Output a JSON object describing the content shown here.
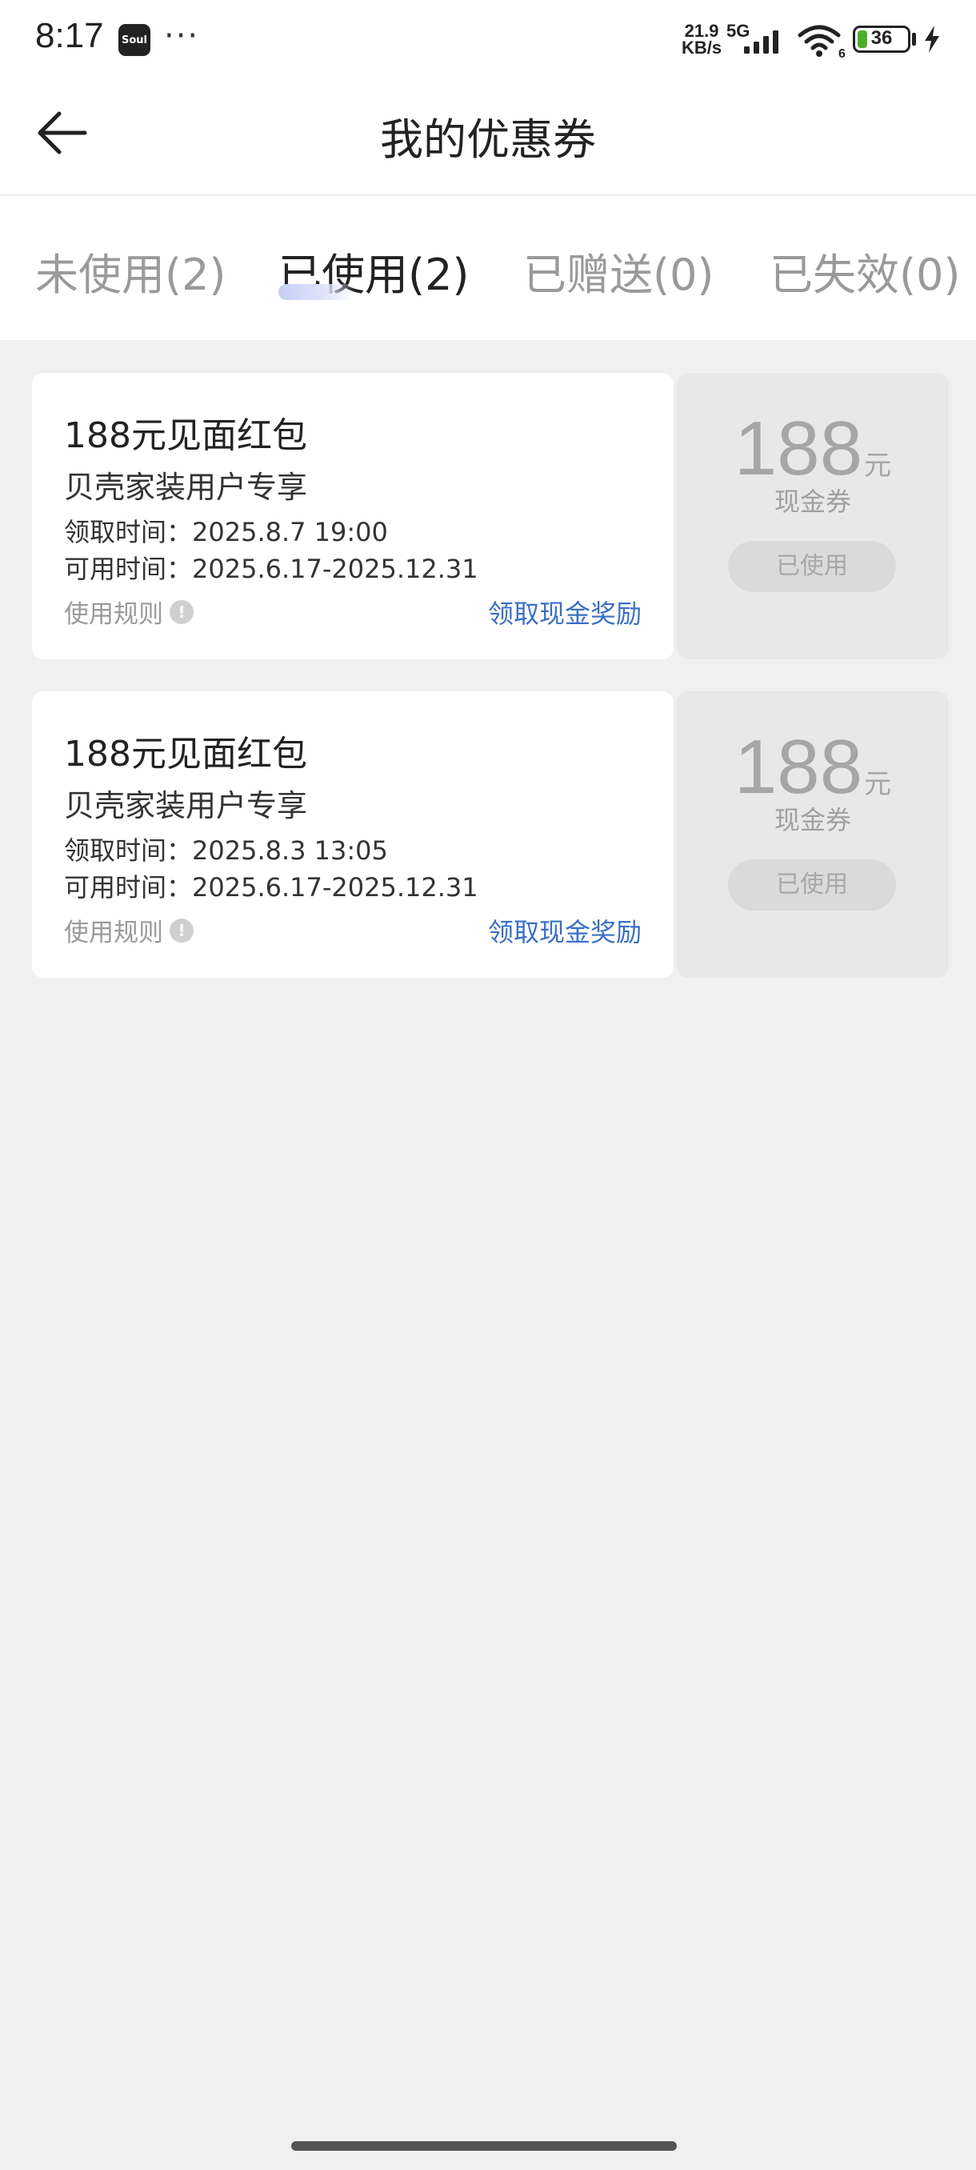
{
  "status_bar": {
    "time": "8:17",
    "app_icon_label": "Soul",
    "more": "···",
    "speed_value": "21.9",
    "speed_unit": "KB/s",
    "network": "5G",
    "wifi_badge": "6",
    "battery": "36"
  },
  "header": {
    "title": "我的优惠券"
  },
  "tabs": [
    {
      "label": "未使用(2)",
      "active": false
    },
    {
      "label": "已使用(2)",
      "active": true
    },
    {
      "label": "已赠送(0)",
      "active": false
    },
    {
      "label": "已失效(0)",
      "active": false
    }
  ],
  "coupons": [
    {
      "title": "188元见面红包",
      "subtitle": "贝壳家装用户专享",
      "claim_time": "领取时间：2025.8.7 19:00",
      "valid_time": "可用时间：2025.6.17-2025.12.31",
      "rules_label": "使用规则",
      "reward_link": "领取现金奖励",
      "amount": "188",
      "unit": "元",
      "type": "现金券",
      "status_button": "已使用"
    },
    {
      "title": "188元见面红包",
      "subtitle": "贝壳家装用户专享",
      "claim_time": "领取时间：2025.8.3 13:05",
      "valid_time": "可用时间：2025.6.17-2025.12.31",
      "rules_label": "使用规则",
      "reward_link": "领取现金奖励",
      "amount": "188",
      "unit": "元",
      "type": "现金券",
      "status_button": "已使用"
    }
  ],
  "colors": {
    "accent_link": "#3a6fc4",
    "battery_fill": "#4caf2a",
    "tab_indicator": "#c6cdf6"
  }
}
